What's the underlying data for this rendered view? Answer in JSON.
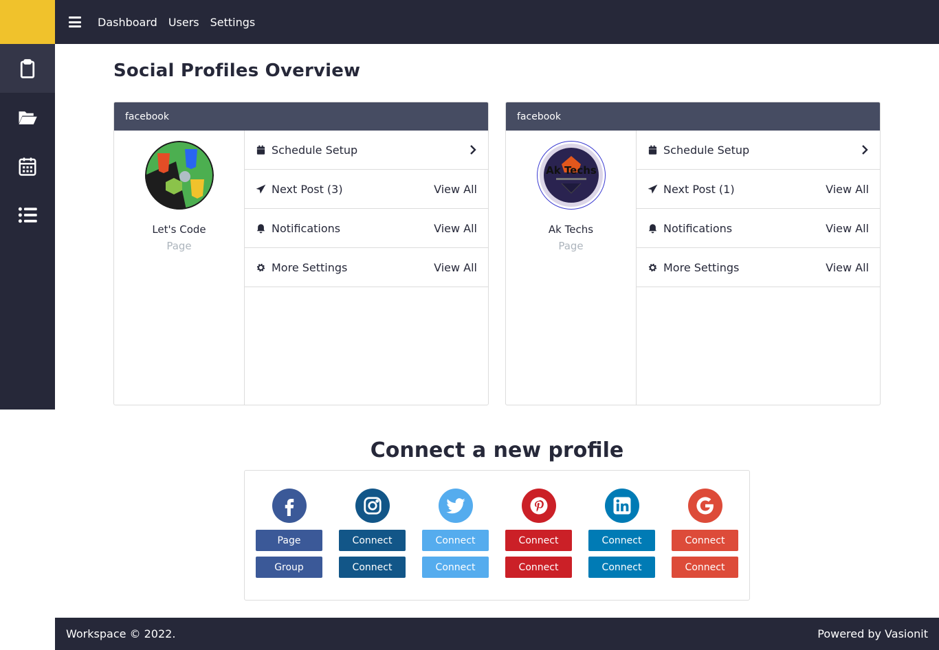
{
  "nav": {
    "links": [
      "Dashboard",
      "Users",
      "Settings"
    ]
  },
  "sidebar": {
    "items": [
      "clipboard-icon",
      "folder-open-icon",
      "calendar-icon",
      "list-icon"
    ]
  },
  "page_title": "Social Profiles Overview",
  "profiles": [
    {
      "network": "facebook",
      "name": "Let's Code",
      "type": "Page",
      "menu": [
        {
          "label": "Schedule Setup",
          "action": ""
        },
        {
          "label": "Next Post (3)",
          "action": "View All"
        },
        {
          "label": "Notifications",
          "action": "View All"
        },
        {
          "label": "More Settings",
          "action": "View All"
        }
      ]
    },
    {
      "network": "facebook",
      "name": "Ak Techs",
      "type": "Page",
      "avatar_text": "Ak Techs",
      "menu": [
        {
          "label": "Schedule Setup",
          "action": ""
        },
        {
          "label": "Next Post (1)",
          "action": "View All"
        },
        {
          "label": "Notifications",
          "action": "View All"
        },
        {
          "label": "More Settings",
          "action": "View All"
        }
      ]
    }
  ],
  "connect": {
    "title": "Connect a new profile",
    "networks": [
      {
        "icon": "facebook-icon",
        "color": "#3b5998",
        "btn_color": "#3b5998",
        "buttons": [
          "Page",
          "Group"
        ]
      },
      {
        "icon": "instagram-icon",
        "color": "#125688",
        "btn_color": "#125688",
        "buttons": [
          "Connect",
          "Connect"
        ]
      },
      {
        "icon": "twitter-icon",
        "color": "#55acee",
        "btn_color": "#55acee",
        "buttons": [
          "Connect",
          "Connect"
        ]
      },
      {
        "icon": "pinterest-icon",
        "color": "#cb2027",
        "btn_color": "#cb2027",
        "buttons": [
          "Connect",
          "Connect"
        ]
      },
      {
        "icon": "linkedin-icon",
        "color": "#007bb5",
        "btn_color": "#007bb5",
        "buttons": [
          "Connect",
          "Connect"
        ]
      },
      {
        "icon": "google-icon",
        "color": "#dd4b39",
        "btn_color": "#dd4b39",
        "buttons": [
          "Connect",
          "Connect"
        ]
      }
    ]
  },
  "footer": {
    "left": "Workspace © 2022.",
    "right": "Powered by Vasionit"
  },
  "colors": {
    "sidebar": "#262839",
    "accent_yellow": "#f0c22c",
    "card_header": "#464c62"
  }
}
